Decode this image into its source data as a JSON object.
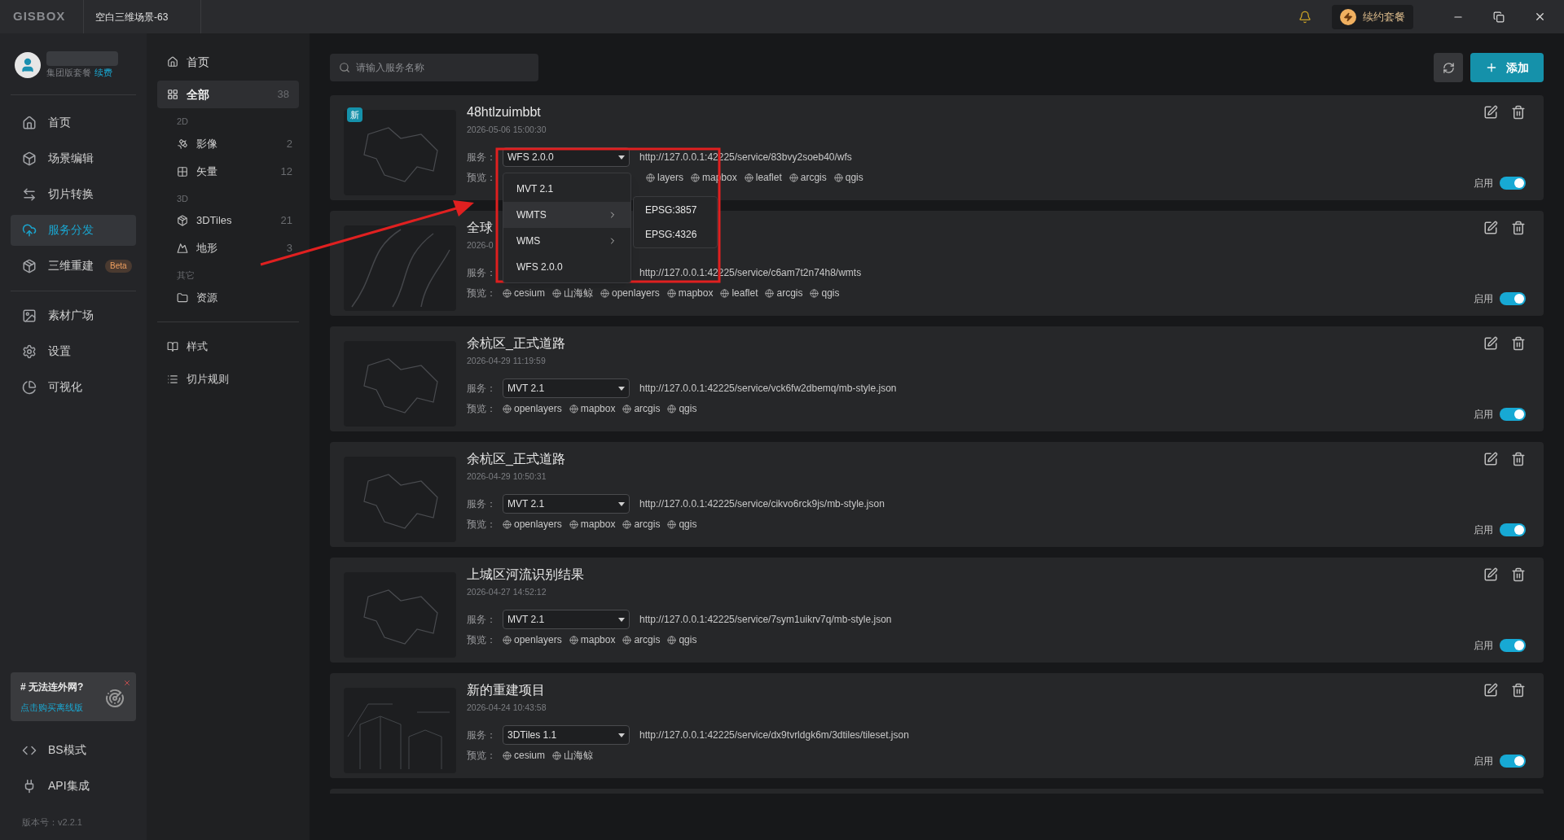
{
  "titlebar": {
    "logo": "GISBOX",
    "tab": "空白三维场景-63",
    "renew_button": "续约套餐"
  },
  "user": {
    "plan": "集团版套餐",
    "renew_link": "续费"
  },
  "nav_groups": [
    {
      "items": [
        {
          "label": "首页",
          "selected": false
        },
        {
          "label": "场景编辑",
          "selected": false
        },
        {
          "label": "切片转换",
          "selected": false
        },
        {
          "label": "服务分发",
          "selected": true
        },
        {
          "label": "三维重建",
          "selected": false,
          "badge": "Beta"
        }
      ]
    },
    {
      "items": [
        {
          "label": "素材广场",
          "selected": false
        },
        {
          "label": "设置",
          "selected": false
        },
        {
          "label": "可视化",
          "selected": false
        }
      ]
    }
  ],
  "promo": {
    "title": "# 无法连外网?",
    "link": "点击购买离线版"
  },
  "bottom_nav": [
    {
      "label": "BS模式"
    },
    {
      "label": "API集成"
    }
  ],
  "version": "版本号：v2.2.1",
  "service_nav": {
    "home": "首页",
    "all": {
      "label": "全部",
      "count": "38",
      "selected": true
    },
    "groups": [
      {
        "label": "2D",
        "items": [
          {
            "label": "影像",
            "count": "2",
            "selected": false
          },
          {
            "label": "矢量",
            "count": "12",
            "selected": false
          }
        ]
      },
      {
        "label": "3D",
        "items": [
          {
            "label": "3DTiles",
            "count": "21",
            "selected": false
          },
          {
            "label": "地形",
            "count": "3",
            "selected": false
          }
        ]
      },
      {
        "label": "其它",
        "items": [
          {
            "label": "资源",
            "selected": false
          }
        ]
      }
    ],
    "extra": [
      {
        "label": "样式"
      },
      {
        "label": "切片规则"
      }
    ]
  },
  "toolbar": {
    "search": {
      "placeholder": "请输入服务名称"
    },
    "add_button": "添加"
  },
  "cards": [
    {
      "title": "48htlzuimbbt",
      "date": "2026-05-06 15:00:30",
      "is_new": true,
      "new_label": "新",
      "kind": "outline",
      "service_label": "服务：",
      "service": "WFS 2.0.0",
      "url": "http://127.0.0.1:42225/service/83bvy2soeb40/wfs",
      "preview_label": "预览：",
      "previews": [
        "layers",
        "mapbox",
        "leaflet",
        "arcgis",
        "qgis"
      ],
      "enabled_label": "启用",
      "enabled": true,
      "menu": {
        "items": [
          {
            "label": "MVT 2.1",
            "has_submenu": false,
            "selected": false
          },
          {
            "label": "WMTS",
            "has_submenu": true,
            "selected": true,
            "children": [
              "EPSG:3857",
              "EPSG:4326"
            ]
          },
          {
            "label": "WMS",
            "has_submenu": true,
            "selected": false
          },
          {
            "label": "WFS 2.0.0",
            "has_submenu": false,
            "selected": false
          }
        ]
      }
    },
    {
      "title": "全球",
      "date": "2026-0",
      "is_new": false,
      "kind": "lines",
      "service_label": "服务：",
      "url": "http://127.0.0.1:42225/service/c6am7t2n74h8/wmts",
      "preview_label": "预览：",
      "previews": [
        "cesium",
        "山海鲸",
        "openlayers",
        "mapbox",
        "leaflet",
        "arcgis",
        "qgis"
      ],
      "enabled_label": "启用",
      "enabled": true
    },
    {
      "title": "余杭区_正式道路",
      "date": "2026-04-29 11:19:59",
      "is_new": false,
      "kind": "outline",
      "service_label": "服务：",
      "service": "MVT 2.1",
      "url": "http://127.0.0.1:42225/service/vck6fw2dbemq/mb-style.json",
      "preview_label": "预览：",
      "previews": [
        "openlayers",
        "mapbox",
        "arcgis",
        "qgis"
      ],
      "enabled_label": "启用",
      "enabled": true
    },
    {
      "title": "余杭区_正式道路",
      "date": "2026-04-29 10:50:31",
      "is_new": false,
      "kind": "outline",
      "service_label": "服务：",
      "service": "MVT 2.1",
      "url": "http://127.0.0.1:42225/service/cikvo6rck9js/mb-style.json",
      "preview_label": "预览：",
      "previews": [
        "openlayers",
        "mapbox",
        "arcgis",
        "qgis"
      ],
      "enabled_label": "启用",
      "enabled": true
    },
    {
      "title": "上城区河流识别结果",
      "date": "2026-04-27 14:52:12",
      "is_new": false,
      "kind": "outline",
      "service_label": "服务：",
      "service": "MVT 2.1",
      "url": "http://127.0.0.1:42225/service/7sym1uikrv7q/mb-style.json",
      "preview_label": "预览：",
      "previews": [
        "openlayers",
        "mapbox",
        "arcgis",
        "qgis"
      ],
      "enabled_label": "启用",
      "enabled": true
    },
    {
      "title": "新的重建项目",
      "date": "2026-04-24 10:43:58",
      "is_new": false,
      "kind": "city",
      "service_label": "服务：",
      "service": "3DTiles 1.1",
      "url": "http://127.0.0.1:42225/service/dx9tvrldgk6m/3dtiles/tileset.json",
      "preview_label": "预览：",
      "previews": [
        "cesium",
        "山海鲸"
      ],
      "enabled_label": "启用",
      "enabled": true
    }
  ]
}
